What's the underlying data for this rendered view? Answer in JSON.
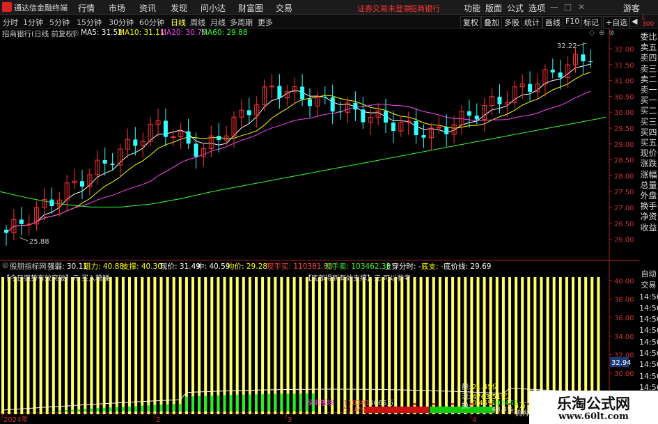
{
  "app": {
    "title": "通达信金融终端",
    "logo_icon": "tdx-logo-icon"
  },
  "menu": [
    "行情",
    "市场",
    "资讯",
    "发现",
    "问小达",
    "财富圈",
    "交易"
  ],
  "status_links": [
    "证券交易未登录",
    "招商银行"
  ],
  "window_menu": [
    "功能",
    "版面",
    "公式",
    "选项",
    "游客"
  ],
  "timeframes": [
    "分时",
    "1分钟",
    "5分钟",
    "15分钟",
    "30分钟",
    "60分钟",
    "日线",
    "周线",
    "月线",
    "多周期",
    "更多"
  ],
  "active_timeframe": "日线",
  "right_tools": [
    "复权",
    "叠加",
    "多股",
    "统计",
    "画线",
    "F10",
    "标记",
    "+自选",
    "◀"
  ],
  "main_chart": {
    "title": "招商银行(日线 前复权)",
    "ma": [
      {
        "label": "MA5: 31.52",
        "color": "#ffffff"
      },
      {
        "label": "MA10: 31.11",
        "color": "#ffff00"
      },
      {
        "label": "MA20: 30.75",
        "color": "#ff44ff"
      },
      {
        "label": "MA60: 29.88",
        "color": "#33ff33"
      }
    ],
    "high_label": "32.22",
    "low_label": "25.88"
  },
  "indicator": {
    "items": [
      {
        "text": "股朋指标网",
        "color": "#cccccc"
      },
      {
        "text": "强弱: 30.11",
        "color": "#ffffff"
      },
      {
        "text": "阻力: 40.88",
        "color": "#ffff00"
      },
      {
        "text": "支撑: 40.30",
        "color": "#ffff00"
      },
      {
        "text": "现价: 31.49",
        "color": "#ffffff"
      },
      {
        "text": "中: 40.59",
        "color": "#ffffff"
      },
      {
        "text": "均价: 29.28",
        "color": "#ffff00"
      },
      {
        "text": "现手买: 110381.00",
        "color": "#ff4444"
      },
      {
        "text": "现手卖: 103462.38",
        "color": "#33ff33"
      },
      {
        "text": "上穿分时: -",
        "color": "#ffffff"
      },
      {
        "text": "底支: -",
        "color": "#ffff00"
      },
      {
        "text": "底价线: 29.69",
        "color": "#ffffff"
      }
    ],
    "note_left": "【今日强势有效突破】元 买入稳赚",
    "note_right": "【底部得到有效支撑】元 可以参考",
    "current_value": "32.94"
  },
  "right_panel": {
    "labels": [
      "委比",
      "卖五",
      "卖四",
      "卖三",
      "卖二",
      "卖一",
      "买一",
      "买二",
      "买三",
      "买四",
      "买五",
      "现价",
      "涨跌",
      "涨幅",
      "总量",
      "外盘",
      "换手",
      "净资",
      "收益"
    ],
    "lower_labels": [
      "自动",
      "交易",
      "14:56",
      "14:56",
      "14:56",
      "14:56",
      "14:56",
      "14:56",
      "14:56",
      "14:56",
      "14:56"
    ],
    "badge": "L 300"
  },
  "bottom_panel": {
    "sector": "深圳板块",
    "vol_1": "110381",
    "vol_2": "4065万",
    "pct_up": "51.6%",
    "pct_down": "48.4%",
    "total_1": "21.45亿",
    "total_2": "4763.51亿",
    "hand": "0.45%",
    "hand2": "103462",
    "unit": "4万",
    "institution": "机构",
    "labels": [
      "额:",
      "流:",
      "换:"
    ]
  },
  "dates": [
    "2024年",
    "2",
    "3",
    "4"
  ],
  "price_axis": [
    "32.00",
    "31.50",
    "31.00",
    "30.50",
    "30.00",
    "29.50",
    "29.00",
    "28.50",
    "28.00",
    "27.50",
    "27.00",
    "26.50",
    "26.00"
  ],
  "ind_axis": [
    "40.00",
    "38.00",
    "36.00",
    "34.00",
    "32.00",
    "30.00"
  ],
  "watermark": {
    "text": "乐淘公式网",
    "url": "www.60lt.com"
  }
}
